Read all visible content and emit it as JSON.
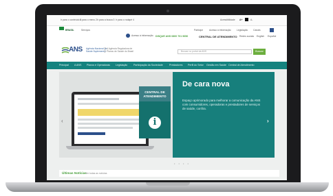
{
  "topbar": {
    "access_links": [
      "Ir para o conteúdo 1",
      "Ir para o menu 2",
      "Ir para a busca 3",
      "Ir para o rodapé 4"
    ],
    "right_links": [
      "Acessibilidade",
      "A+",
      "A-",
      "Alto contraste"
    ]
  },
  "govbar": {
    "brasil": "BRASIL",
    "servicos": "Serviços",
    "right_links": [
      "Participe",
      "Acesso à informação",
      "Legislação",
      "Canais"
    ]
  },
  "infobar": {
    "info_label": "Acesso à informação",
    "disque": "DISQUE ANS 0800 701 9656",
    "central": "CENTRAL DE ATENDIMENTO",
    "social": [
      "Redes sociais",
      "English",
      "Español"
    ]
  },
  "header": {
    "logo": "ANS",
    "logo_sub_1": "Agência Nacional de",
    "logo_sub_2": "Saúde Suplementar",
    "logo_sub_3": "A Agência Reguladora de",
    "logo_sub_4": "Planos de Saúde do Brasil",
    "search_placeholder": "Buscar no portal da ANS",
    "search_button": "Buscar"
  },
  "nav": [
    "Principal",
    "A ANS",
    "Planos e Operadoras",
    "Legislação",
    "Participação da Sociedade",
    "Prestadores",
    "Perfil do Setor",
    "Gestão em Saúde",
    "Central de Atendimento"
  ],
  "hero": {
    "badge": "CENTRAL DE ATENDIMENTO",
    "badge_icon": "i",
    "title": "De cara nova",
    "text": "Espaço aprimorado para melhorar a comunicação da ANS com consumidores, operadoras e prestadores de serviços de saúde, confira.",
    "prev": "‹",
    "next": "›",
    "dots": "• • • •"
  },
  "news": {
    "title": "Últimas Notícias",
    "link": "Ver todas as notícias"
  },
  "colors": {
    "teal": "#15837f",
    "green": "#6cae3e",
    "ans_blue": "#2c4f8a"
  }
}
